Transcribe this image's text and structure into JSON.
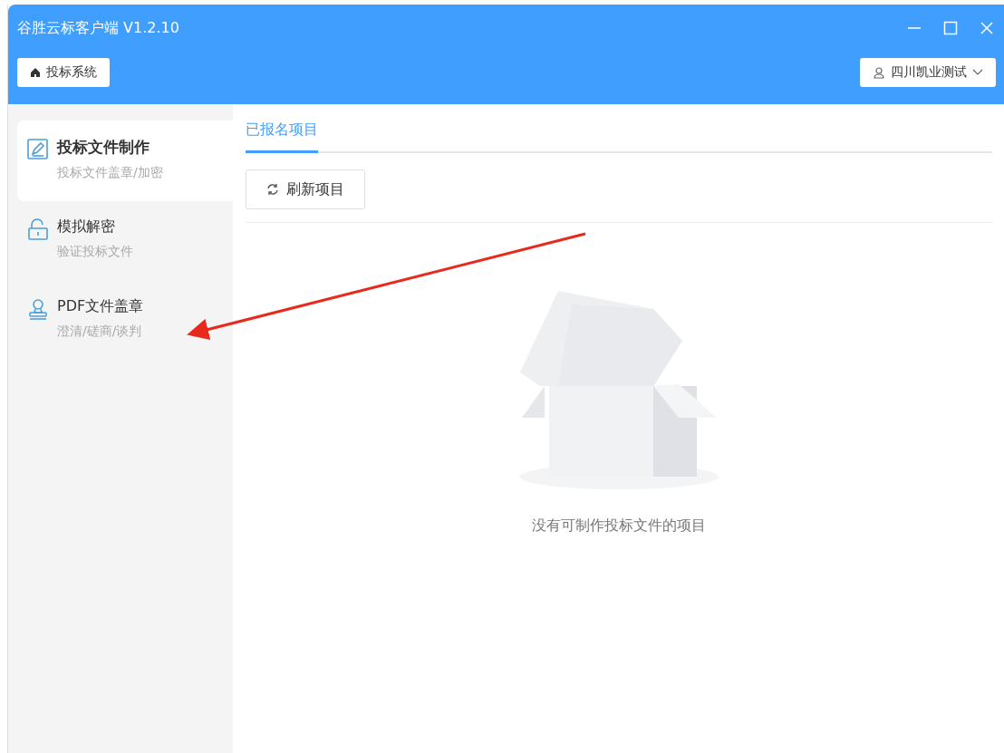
{
  "window": {
    "title": "谷胜云标客户端 V1.2.10"
  },
  "header": {
    "home_button": "投标系统",
    "user_menu": "四川凯业测试"
  },
  "sidebar": {
    "items": [
      {
        "kind": "edit",
        "title": "投标文件制作",
        "subtitle": "投标文件盖章/加密",
        "selected": true
      },
      {
        "kind": "unlock",
        "title": "模拟解密",
        "subtitle": "验证投标文件",
        "selected": false
      },
      {
        "kind": "stamp",
        "title": "PDF文件盖章",
        "subtitle": "澄清/磋商/谈判",
        "selected": false
      }
    ]
  },
  "tabs": [
    {
      "label": "已报名项目",
      "selected": true
    }
  ],
  "toolbar": {
    "refresh_button": "刷新项目"
  },
  "empty_state": {
    "message": "没有可制作投标文件的项目"
  },
  "annotation": {
    "kind": "arrow"
  }
}
